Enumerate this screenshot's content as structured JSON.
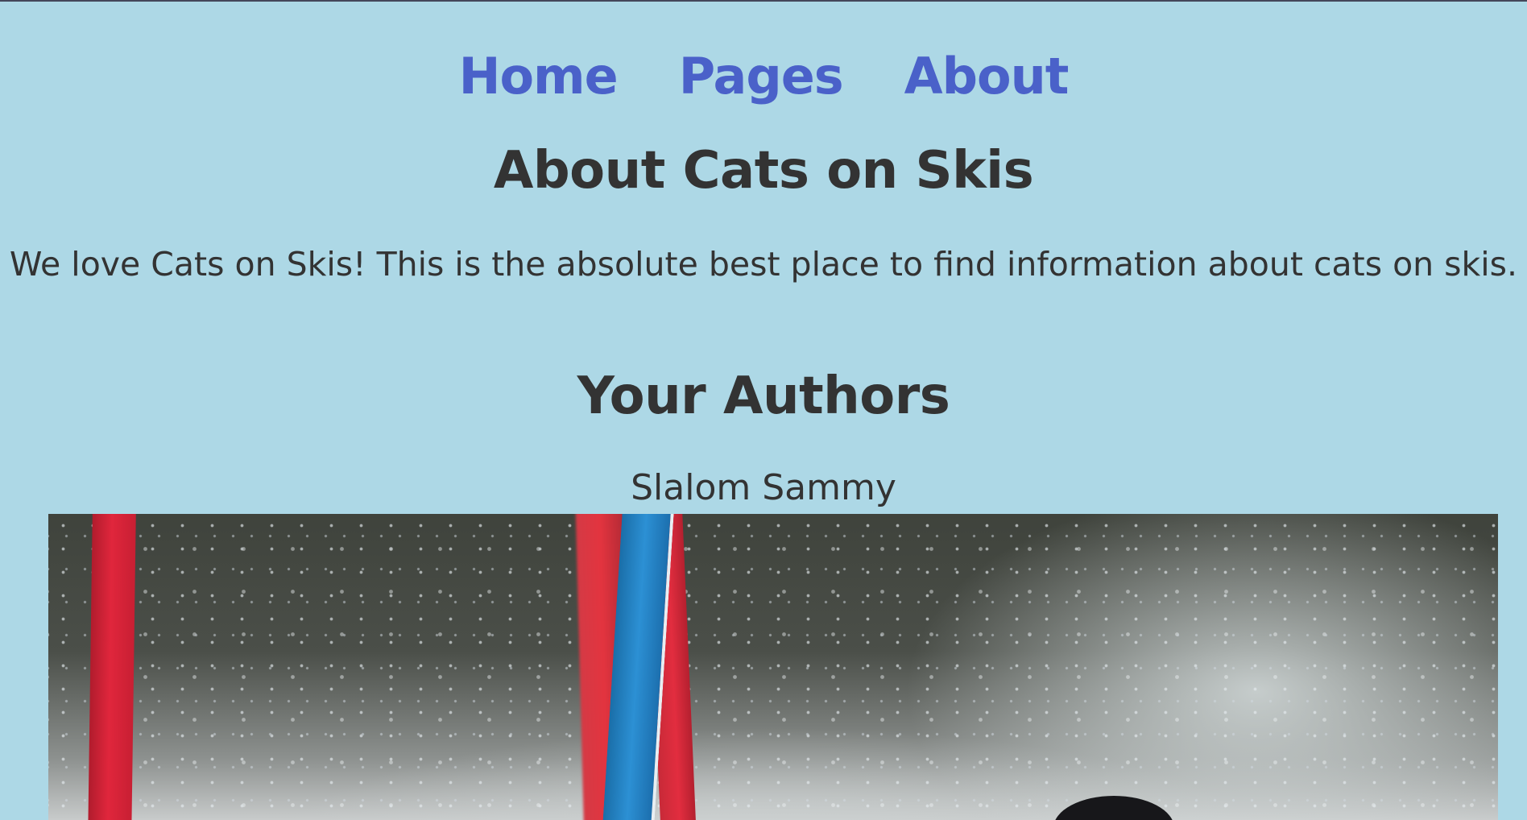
{
  "nav": {
    "items": [
      {
        "label": "Home"
      },
      {
        "label": "Pages"
      },
      {
        "label": "About"
      }
    ]
  },
  "page": {
    "title": "About Cats on Skis",
    "intro": "We love Cats on Skis! This is the absolute best place to find information about cats on skis."
  },
  "authors": {
    "heading": "Your Authors",
    "list": [
      {
        "name": "Slalom Sammy"
      }
    ]
  },
  "colors": {
    "background": "#add8e6",
    "link": "#4a61c9",
    "text": "#333333",
    "top_border": "#44465a"
  }
}
